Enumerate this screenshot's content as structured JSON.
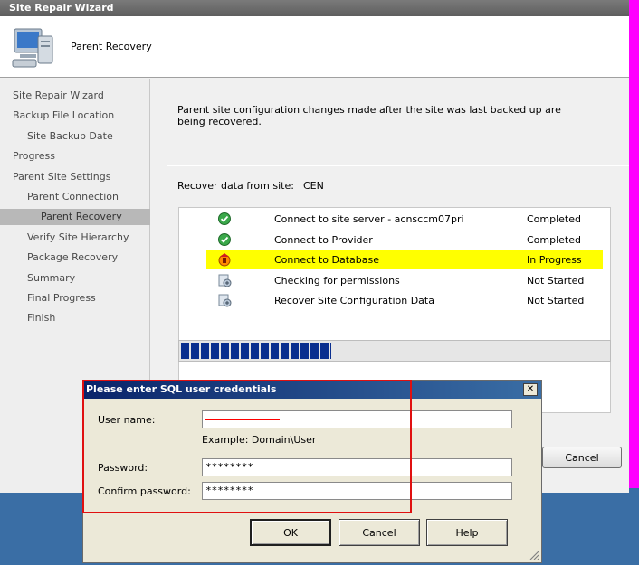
{
  "wizard": {
    "title": "Site Repair Wizard",
    "page_title": "Parent Recovery",
    "nav": [
      {
        "label": "Site Repair Wizard",
        "indent": 0
      },
      {
        "label": "Backup File Location",
        "indent": 0
      },
      {
        "label": "Site Backup Date",
        "indent": 1
      },
      {
        "label": "Progress",
        "indent": 0
      },
      {
        "label": "Parent Site Settings",
        "indent": 0
      },
      {
        "label": "Parent Connection",
        "indent": 1
      },
      {
        "label": "Parent Recovery",
        "indent": 2
      },
      {
        "label": "Verify Site Hierarchy",
        "indent": 1
      },
      {
        "label": "Package Recovery",
        "indent": 1
      },
      {
        "label": "Summary",
        "indent": 1
      },
      {
        "label": "Final Progress",
        "indent": 1
      },
      {
        "label": "Finish",
        "indent": 1
      }
    ],
    "active_nav_index": 6,
    "intro_text": "Parent site configuration changes made after the site was last backed up are being recovered.",
    "recover_label": "Recover data from site:",
    "recover_site": "CEN",
    "tasks": [
      {
        "name": "Connect to site server - acnsccm07pri",
        "status": "Completed",
        "icon": "check-icon"
      },
      {
        "name": "Connect to Provider",
        "status": "Completed",
        "icon": "check-icon"
      },
      {
        "name": "Connect to Database",
        "status": "In Progress",
        "icon": "in-progress-icon",
        "highlight": true
      },
      {
        "name": "Checking for permissions",
        "status": "Not Started",
        "icon": "pending-icon"
      },
      {
        "name": "Recover Site Configuration Data",
        "status": "Not Started",
        "icon": "pending-icon"
      }
    ],
    "progress_fraction": 0.35,
    "cancel_label": "Cancel"
  },
  "dialog": {
    "title": "Please enter SQL user credentials",
    "close_glyph": "✕",
    "username_label": "User name:",
    "username_example": "Example: Domain\\User",
    "password_label": "Password:",
    "password_value": "********",
    "confirm_label": "Confirm password:",
    "confirm_value": "********",
    "ok_label": "OK",
    "cancel_label": "Cancel",
    "help_label": "Help"
  },
  "colors": {
    "highlight": "#ffff00",
    "progress": "#0a2f8f",
    "annotation": "#e01010"
  }
}
